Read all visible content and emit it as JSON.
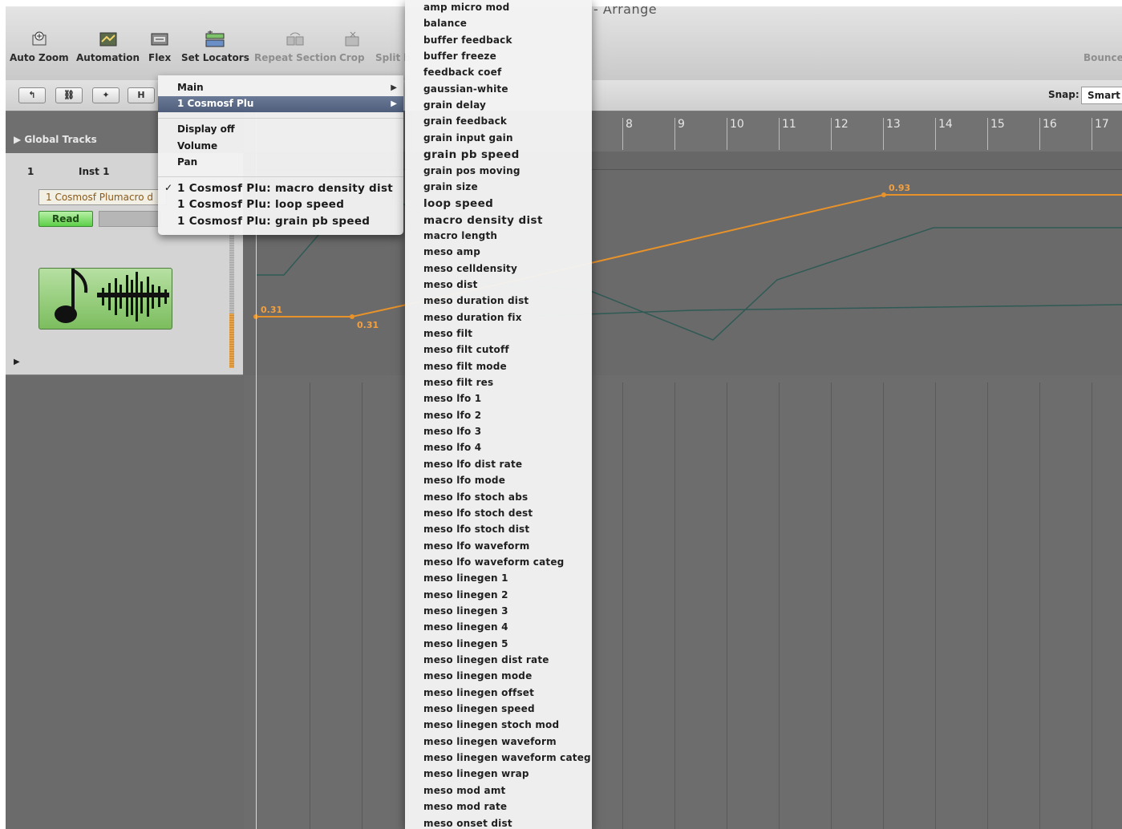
{
  "window": {
    "title": "Arrange"
  },
  "toolbar": {
    "buttons": [
      {
        "label": "Auto Zoom",
        "icon": "auto-zoom-icon",
        "enabled": true
      },
      {
        "label": "Automation",
        "icon": "automation-icon",
        "enabled": true
      },
      {
        "label": "Flex",
        "icon": "flex-icon",
        "enabled": true
      },
      {
        "label": "Set Locators",
        "icon": "set-locators-icon",
        "enabled": true
      },
      {
        "label": "Repeat Section",
        "icon": "repeat-section-icon",
        "enabled": false
      },
      {
        "label": "Crop",
        "icon": "crop-icon",
        "enabled": false
      },
      {
        "label": "Split b",
        "icon": "split-icon",
        "enabled": false
      },
      {
        "label": "Bounce",
        "icon": "bounce-icon",
        "enabled": false
      }
    ]
  },
  "secondary_bar": {
    "buttons": [
      "↰",
      "⛓",
      "✦",
      "H"
    ],
    "snap_label": "Snap:",
    "snap_value": "Smart"
  },
  "tracks_panel": {
    "global_tracks_label": "Global Tracks",
    "track": {
      "number": "1",
      "name": "Inst 1",
      "automation_param": "1 Cosmosf Plumacro d",
      "mode_button": "Read"
    }
  },
  "ruler": {
    "bars": [
      "8",
      "9",
      "10",
      "11",
      "12",
      "13",
      "14",
      "15",
      "16",
      "17"
    ]
  },
  "automation": {
    "points": [
      {
        "label": "0.31"
      },
      {
        "label": "0.31"
      },
      {
        "label": "0.93"
      }
    ],
    "colors": {
      "automation": "#e8922a",
      "secondary": "#2f5a55"
    }
  },
  "popup_menu": {
    "items": [
      {
        "label": "Main",
        "submenu": true
      },
      {
        "label": "1 Cosmosf Plu",
        "submenu": true,
        "highlighted": true
      }
    ],
    "display_items": [
      "Display off",
      "Volume",
      "Pan"
    ],
    "param_items": [
      {
        "label": "1 Cosmosf Plu: macro density dist",
        "checked": true
      },
      {
        "label": "1 Cosmosf Plu: loop speed",
        "checked": false
      },
      {
        "label": "1 Cosmosf Plu: grain pb speed",
        "checked": false
      }
    ],
    "checkmark": "✓"
  },
  "submenu": {
    "items": [
      "amp micro mod",
      "balance",
      "buffer feedback",
      "buffer freeze",
      "feedback coef",
      "gaussian-white",
      "grain delay",
      "grain feedback",
      "grain input gain",
      "grain pb speed",
      "grain pos moving",
      "grain size",
      "loop speed",
      "macro density dist",
      "macro length",
      "meso amp",
      "meso celldensity",
      "meso dist",
      "meso duration dist",
      "meso duration fix",
      "meso filt",
      "meso filt cutoff",
      "meso filt mode",
      "meso filt res",
      "meso lfo 1",
      "meso lfo 2",
      "meso lfo 3",
      "meso lfo 4",
      "meso lfo dist rate",
      "meso lfo mode",
      "meso lfo stoch abs",
      "meso lfo stoch dest",
      "meso lfo stoch dist",
      "meso lfo waveform",
      "meso lfo waveform categ",
      "meso linegen 1",
      "meso linegen 2",
      "meso linegen 3",
      "meso linegen 4",
      "meso linegen 5",
      "meso linegen dist rate",
      "meso linegen mode",
      "meso linegen offset",
      "meso linegen speed",
      "meso linegen stoch mod",
      "meso linegen waveform",
      "meso linegen waveform categ",
      "meso linegen wrap",
      "meso mod amt",
      "meso mod rate",
      "meso onset dist"
    ],
    "bold_items": [
      "grain pb speed",
      "loop speed",
      "macro density dist"
    ]
  }
}
